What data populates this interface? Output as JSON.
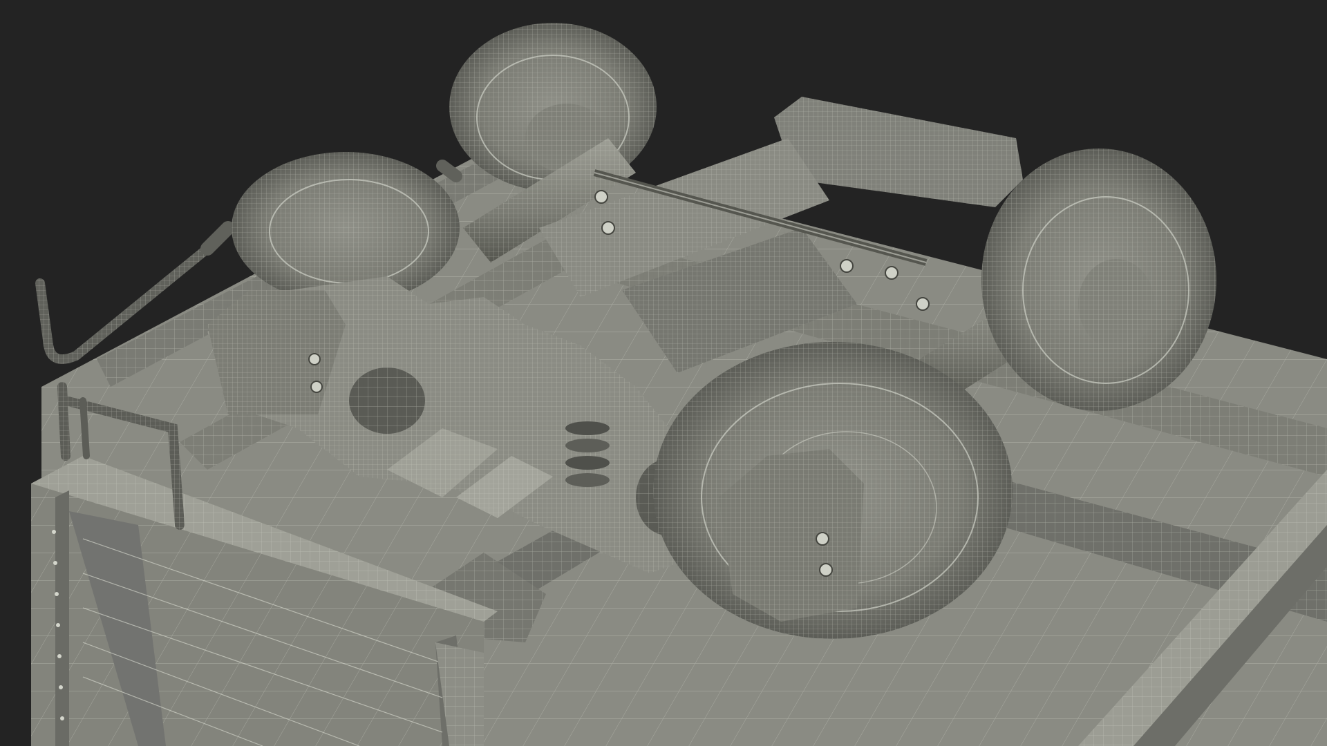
{
  "scene": {
    "background_color": "#232323",
    "surface_color": "#8a8b83",
    "surface_dark": "#5f605a",
    "surface_light": "#a4a59c",
    "wire_color": "#d4d6cc",
    "wire_dark": "#3b3c37"
  }
}
